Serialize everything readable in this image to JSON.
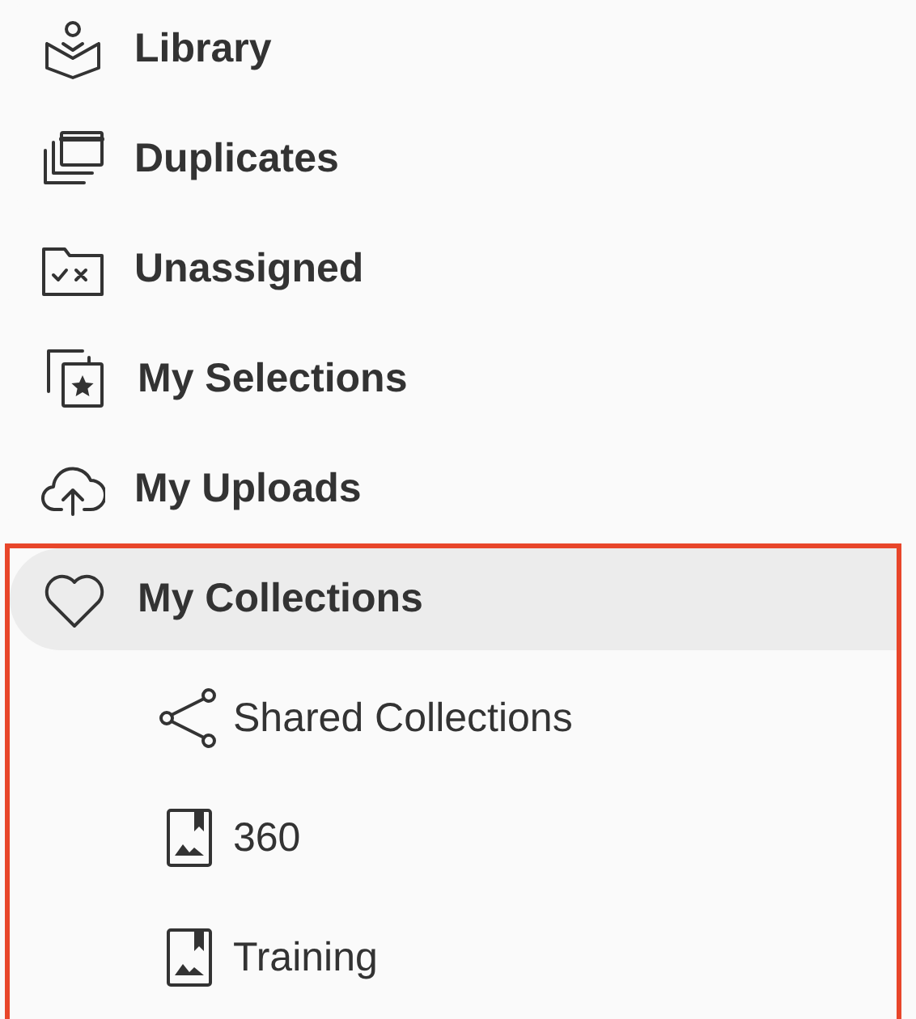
{
  "nav": {
    "items": [
      {
        "label": "Library",
        "selected": false
      },
      {
        "label": "Duplicates",
        "selected": false
      },
      {
        "label": "Unassigned",
        "selected": false
      },
      {
        "label": "My Selections",
        "selected": false
      },
      {
        "label": "My Uploads",
        "selected": false
      },
      {
        "label": "My Collections",
        "selected": true,
        "highlighted": true,
        "children": [
          {
            "label": "Shared Collections",
            "kind": "shared"
          },
          {
            "label": "360",
            "kind": "collection"
          },
          {
            "label": "Training",
            "kind": "collection"
          }
        ]
      }
    ]
  }
}
